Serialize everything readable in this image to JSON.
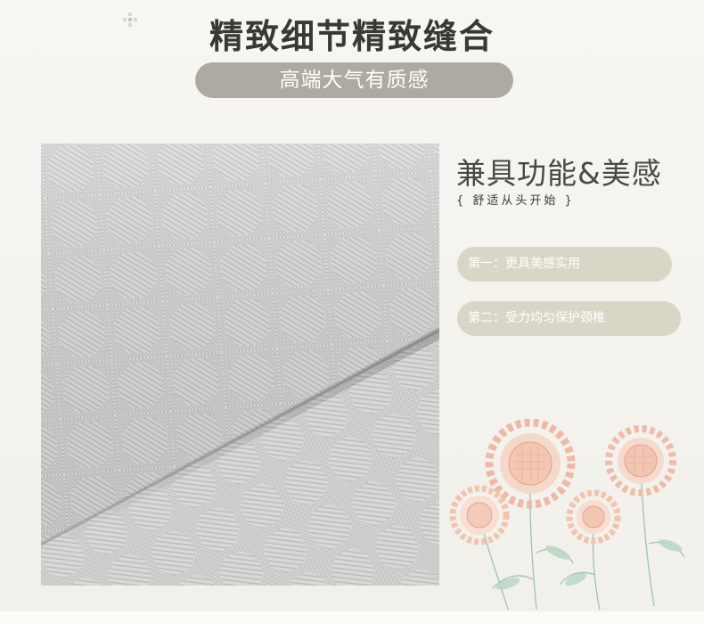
{
  "header": {
    "title": "精致细节精致缝合",
    "subtitle": "高端大气有质感"
  },
  "side": {
    "heading": "兼具功能&美感",
    "subheading": "{  舒适从头开始  }",
    "features": [
      {
        "label": "第一：更具美感实用"
      },
      {
        "label": "第二：受力均匀保护颈椎"
      }
    ]
  },
  "images": {
    "fabric": "quilted-honeycomb-fabric-closeup",
    "flowers": "watercolor-sunflowers-illustration",
    "decoration": "small-cross-ornament"
  },
  "colors": {
    "background": "#f8f7f3",
    "pill_main": "#aeaaa1",
    "pill_feature": "#dad6c7",
    "title_text": "#3a3834",
    "fabric_base": "#c9c9c7"
  }
}
